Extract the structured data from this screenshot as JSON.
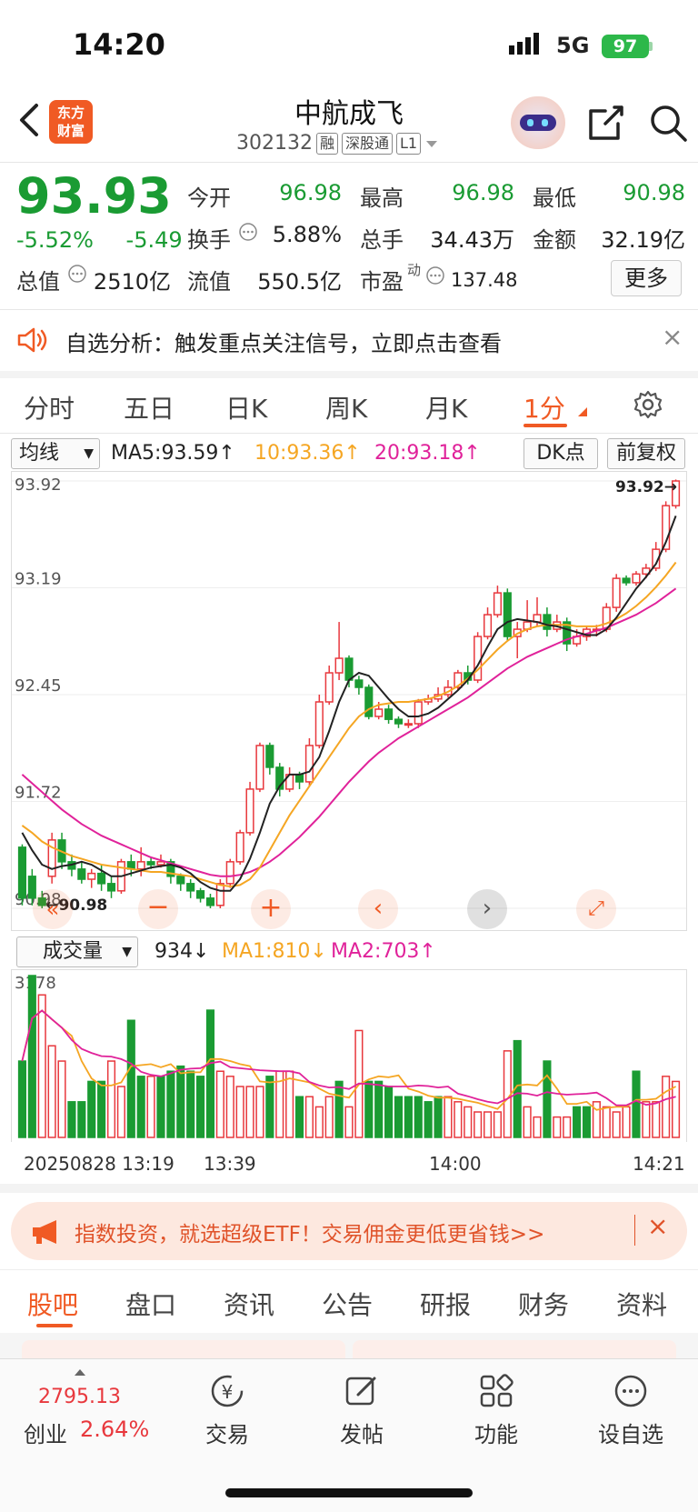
{
  "status_bar": {
    "time": "14:20",
    "network": "5G",
    "battery": "97"
  },
  "header": {
    "logo_text_1": "东方",
    "logo_text_2": "财富",
    "title": "中航成飞",
    "code": "302132",
    "tags": [
      "融",
      "深股通",
      "L1"
    ]
  },
  "quote": {
    "price": "93.93",
    "change_pct": "-5.52%",
    "change": "-5.49",
    "open_label": "今开",
    "open": "96.98",
    "high_label": "最高",
    "high": "96.98",
    "low_label": "最低",
    "low": "90.98",
    "turnover_label": "换手",
    "turnover": "5.88%",
    "volume_label": "总手",
    "volume": "34.43万",
    "amount_label": "金额",
    "amount": "32.19亿",
    "mktcap_label": "总值",
    "mktcap": "2510亿",
    "float_label": "流值",
    "float": "550.5亿",
    "pe_label": "市盈",
    "pe_sup": "动",
    "pe": "137.48",
    "more": "更多"
  },
  "banner": {
    "text": "自选分析：触发重点关注信号，立即点击查看",
    "close": "×"
  },
  "chart_tabs": [
    {
      "label": "分时"
    },
    {
      "label": "五日"
    },
    {
      "label": "日K"
    },
    {
      "label": "周K"
    },
    {
      "label": "月K"
    },
    {
      "label": "1分"
    }
  ],
  "ma_bar": {
    "select": "均线",
    "ma5": "MA5:93.59↑",
    "ma10": "10:93.36↑",
    "ma20": "20:93.18↑",
    "dk": "DK点",
    "fq": "前复权"
  },
  "colors": {
    "up": "#e8383d",
    "down": "#1a9b33",
    "ma5": "#222222",
    "ma10": "#f5a623",
    "ma20": "#e0229a",
    "accent": "#f05a24"
  },
  "chart_data": {
    "type": "candlestick",
    "ylim": [
      90.98,
      93.92
    ],
    "y_ticks": [
      "93.92",
      "93.19",
      "92.45",
      "91.72",
      "90.98"
    ],
    "high_label": "93.92→",
    "low_label": "←90.98",
    "candles": [
      [
        91.4,
        91.05,
        91.42,
        91.0
      ],
      [
        91.2,
        91.05,
        91.25,
        91.0
      ],
      [
        91.05,
        91.0,
        91.1,
        90.98
      ],
      [
        91.2,
        91.45,
        91.5,
        91.15
      ],
      [
        91.45,
        91.3,
        91.5,
        91.25
      ],
      [
        91.3,
        91.25,
        91.35,
        91.2
      ],
      [
        91.25,
        91.18,
        91.3,
        91.15
      ],
      [
        91.18,
        91.22,
        91.25,
        91.12
      ],
      [
        91.22,
        91.15,
        91.28,
        91.1
      ],
      [
        91.15,
        91.1,
        91.2,
        91.05
      ],
      [
        91.1,
        91.3,
        91.32,
        91.08
      ],
      [
        91.3,
        91.25,
        91.35,
        91.2
      ],
      [
        91.25,
        91.3,
        91.4,
        91.2
      ],
      [
        91.3,
        91.28,
        91.33,
        91.25
      ],
      [
        91.28,
        91.3,
        91.35,
        91.26
      ],
      [
        91.3,
        91.2,
        91.32,
        91.15
      ],
      [
        91.2,
        91.15,
        91.22,
        91.1
      ],
      [
        91.15,
        91.1,
        91.18,
        91.05
      ],
      [
        91.1,
        91.05,
        91.12,
        91.02
      ],
      [
        91.05,
        91.0,
        91.08,
        90.98
      ],
      [
        91.0,
        91.15,
        91.18,
        90.98
      ],
      [
        91.15,
        91.3,
        91.32,
        91.12
      ],
      [
        91.3,
        91.5,
        91.52,
        91.28
      ],
      [
        91.5,
        91.8,
        91.85,
        91.48
      ],
      [
        91.8,
        92.1,
        92.12,
        91.78
      ],
      [
        92.1,
        91.95,
        92.12,
        91.9
      ],
      [
        91.95,
        91.8,
        91.98,
        91.75
      ],
      [
        91.8,
        91.9,
        91.95,
        91.78
      ],
      [
        91.9,
        91.85,
        91.92,
        91.8
      ],
      [
        91.85,
        92.1,
        92.15,
        91.82
      ],
      [
        92.1,
        92.4,
        92.45,
        92.08
      ],
      [
        92.4,
        92.6,
        92.65,
        92.38
      ],
      [
        92.6,
        92.7,
        92.95,
        92.55
      ],
      [
        92.7,
        92.55,
        92.72,
        92.5
      ],
      [
        92.55,
        92.5,
        92.58,
        92.45
      ],
      [
        92.5,
        92.3,
        92.52,
        92.28
      ],
      [
        92.3,
        92.35,
        92.4,
        92.28
      ],
      [
        92.35,
        92.28,
        92.38,
        92.25
      ],
      [
        92.28,
        92.25,
        92.3,
        92.22
      ],
      [
        92.25,
        92.25,
        92.28,
        92.22
      ],
      [
        92.25,
        92.4,
        92.42,
        92.22
      ],
      [
        92.4,
        92.42,
        92.45,
        92.38
      ],
      [
        92.42,
        92.45,
        92.5,
        92.4
      ],
      [
        92.45,
        92.5,
        92.55,
        92.43
      ],
      [
        92.5,
        92.6,
        92.62,
        92.48
      ],
      [
        92.6,
        92.55,
        92.65,
        92.52
      ],
      [
        92.55,
        92.85,
        92.88,
        92.53
      ],
      [
        92.85,
        93.0,
        93.05,
        92.83
      ],
      [
        93.0,
        93.15,
        93.2,
        92.98
      ],
      [
        93.15,
        92.85,
        93.18,
        92.82
      ],
      [
        92.85,
        92.9,
        92.95,
        92.7
      ],
      [
        92.9,
        92.95,
        93.1,
        92.88
      ],
      [
        92.95,
        93.0,
        93.12,
        92.92
      ],
      [
        93.0,
        92.9,
        93.05,
        92.85
      ],
      [
        92.9,
        92.95,
        93.0,
        92.88
      ],
      [
        92.95,
        92.8,
        92.98,
        92.75
      ],
      [
        92.8,
        92.85,
        92.9,
        92.78
      ],
      [
        92.85,
        92.9,
        92.92,
        92.82
      ],
      [
        92.9,
        92.9,
        92.93,
        92.85
      ],
      [
        92.9,
        93.05,
        93.08,
        92.88
      ],
      [
        93.05,
        93.25,
        93.28,
        93.02
      ],
      [
        93.25,
        93.22,
        93.27,
        93.2
      ],
      [
        93.22,
        93.28,
        93.3,
        93.2
      ],
      [
        93.28,
        93.32,
        93.35,
        93.25
      ],
      [
        93.32,
        93.45,
        93.5,
        93.3
      ],
      [
        93.45,
        93.75,
        93.78,
        93.43
      ],
      [
        93.75,
        93.92,
        93.93,
        93.73
      ]
    ],
    "volumes": [
      [
        1500,
        "down"
      ],
      [
        3180,
        "down"
      ],
      [
        2800,
        "up"
      ],
      [
        1800,
        "up"
      ],
      [
        1500,
        "up"
      ],
      [
        700,
        "down"
      ],
      [
        700,
        "down"
      ],
      [
        1100,
        "down"
      ],
      [
        1100,
        "down"
      ],
      [
        1500,
        "up"
      ],
      [
        1000,
        "up"
      ],
      [
        2300,
        "down"
      ],
      [
        1200,
        "down"
      ],
      [
        1200,
        "up"
      ],
      [
        1200,
        "down"
      ],
      [
        1300,
        "down"
      ],
      [
        1400,
        "down"
      ],
      [
        1300,
        "down"
      ],
      [
        1200,
        "down"
      ],
      [
        2500,
        "down"
      ],
      [
        1300,
        "up"
      ],
      [
        1200,
        "up"
      ],
      [
        1000,
        "up"
      ],
      [
        1000,
        "up"
      ],
      [
        1000,
        "up"
      ],
      [
        1200,
        "down"
      ],
      [
        1300,
        "up"
      ],
      [
        1300,
        "up"
      ],
      [
        800,
        "down"
      ],
      [
        800,
        "up"
      ],
      [
        600,
        "up"
      ],
      [
        800,
        "up"
      ],
      [
        1100,
        "down"
      ],
      [
        600,
        "up"
      ],
      [
        2100,
        "up"
      ],
      [
        1100,
        "down"
      ],
      [
        1100,
        "down"
      ],
      [
        1000,
        "down"
      ],
      [
        800,
        "down"
      ],
      [
        800,
        "down"
      ],
      [
        800,
        "down"
      ],
      [
        700,
        "down"
      ],
      [
        800,
        "down"
      ],
      [
        800,
        "up"
      ],
      [
        700,
        "up"
      ],
      [
        600,
        "up"
      ],
      [
        500,
        "up"
      ],
      [
        500,
        "up"
      ],
      [
        500,
        "up"
      ],
      [
        1700,
        "up"
      ],
      [
        1900,
        "down"
      ],
      [
        600,
        "up"
      ],
      [
        400,
        "up"
      ],
      [
        1500,
        "down"
      ],
      [
        400,
        "up"
      ],
      [
        400,
        "up"
      ],
      [
        600,
        "down"
      ],
      [
        600,
        "down"
      ],
      [
        700,
        "up"
      ],
      [
        600,
        "up"
      ],
      [
        500,
        "up"
      ],
      [
        600,
        "up"
      ],
      [
        1300,
        "down"
      ],
      [
        700,
        "up"
      ],
      [
        700,
        "up"
      ],
      [
        1200,
        "up"
      ],
      [
        1100,
        "up"
      ]
    ],
    "ma5": [
      91.5,
      91.38,
      91.28,
      91.25,
      91.27,
      91.28,
      91.3,
      91.28,
      91.24,
      91.2,
      91.2,
      91.22,
      91.24,
      91.26,
      91.27,
      91.28,
      91.26,
      91.22,
      91.16,
      91.12,
      91.1,
      91.1,
      91.18,
      91.32,
      91.5,
      91.7,
      91.82,
      91.9,
      91.9,
      91.92,
      92.02,
      92.2,
      92.4,
      92.55,
      92.6,
      92.58,
      92.5,
      92.42,
      92.35,
      92.3,
      92.3,
      92.32,
      92.36,
      92.42,
      92.48,
      92.55,
      92.65,
      92.78,
      92.9,
      92.95,
      92.97,
      92.96,
      92.95,
      92.93,
      92.92,
      92.9,
      92.88,
      92.86,
      92.86,
      92.9,
      92.98,
      93.08,
      93.18,
      93.26,
      93.35,
      93.5,
      93.68
    ],
    "ma10": [
      91.55,
      91.5,
      91.44,
      91.4,
      91.37,
      91.34,
      91.32,
      91.3,
      91.28,
      91.27,
      91.26,
      91.25,
      91.24,
      91.23,
      91.23,
      91.22,
      91.21,
      91.2,
      91.18,
      91.16,
      91.14,
      91.13,
      91.14,
      91.18,
      91.26,
      91.38,
      91.5,
      91.62,
      91.72,
      91.82,
      91.92,
      92.02,
      92.12,
      92.22,
      92.3,
      92.35,
      92.38,
      92.39,
      92.4,
      92.4,
      92.41,
      92.42,
      92.44,
      92.47,
      92.51,
      92.56,
      92.62,
      92.69,
      92.76,
      92.82,
      92.87,
      92.9,
      92.92,
      92.93,
      92.93,
      92.93,
      92.92,
      92.92,
      92.92,
      92.94,
      92.97,
      93.01,
      93.06,
      93.12,
      93.19,
      93.27,
      93.36
    ],
    "ma20": [
      91.9,
      91.84,
      91.78,
      91.72,
      91.66,
      91.61,
      91.56,
      91.52,
      91.48,
      91.45,
      91.42,
      91.39,
      91.36,
      91.33,
      91.31,
      91.29,
      91.27,
      91.25,
      91.23,
      91.21,
      91.2,
      91.2,
      91.21,
      91.23,
      91.26,
      91.3,
      91.35,
      91.41,
      91.47,
      91.54,
      91.61,
      91.69,
      91.77,
      91.85,
      91.92,
      91.99,
      92.05,
      92.1,
      92.15,
      92.19,
      92.23,
      92.27,
      92.31,
      92.35,
      92.39,
      92.43,
      92.48,
      92.53,
      92.58,
      92.63,
      92.67,
      92.71,
      92.74,
      92.77,
      92.8,
      92.83,
      92.85,
      92.87,
      92.89,
      92.91,
      92.94,
      92.97,
      93.0,
      93.04,
      93.08,
      93.13,
      93.18
    ]
  },
  "vol_bar": {
    "select": "成交量",
    "vol": "934↓",
    "ma1": "MA1:810↓",
    "ma2": "MA2:703↑",
    "max": "3178"
  },
  "time_axis": {
    "t0": "20250828 13:19",
    "t1": "13:39",
    "t2": "14:00",
    "t3": "14:21"
  },
  "ad": {
    "text": "指数投资，就选超级ETF！交易佣金更低更省钱>>",
    "close": "×"
  },
  "bottom_tabs": [
    {
      "label": "股吧"
    },
    {
      "label": "盘口"
    },
    {
      "label": "资讯"
    },
    {
      "label": "公告"
    },
    {
      "label": "研报"
    },
    {
      "label": "财务"
    },
    {
      "label": "资料"
    }
  ],
  "bottom_nav": {
    "index_value": "2795.13",
    "index_name": "创业",
    "index_pct": "2.64%",
    "trade": "交易",
    "post": "发帖",
    "func": "功能",
    "watch": "设自选"
  }
}
